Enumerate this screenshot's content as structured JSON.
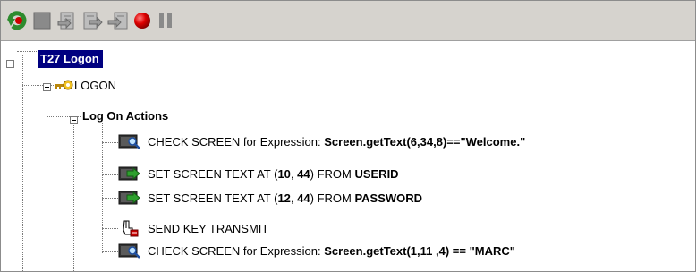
{
  "toolbar": {
    "buttons": [
      {
        "name": "run-icon",
        "color": "#2e8b2e"
      },
      {
        "name": "stop-icon",
        "color": "#808080"
      },
      {
        "name": "step-into-icon",
        "color": "#7a7a7a"
      },
      {
        "name": "step-over-icon",
        "color": "#7a7a7a"
      },
      {
        "name": "step-out-icon",
        "color": "#7a7a7a"
      },
      {
        "name": "record-icon",
        "color": "#cc0000"
      },
      {
        "name": "pause-icon",
        "color": "#7a7a7a"
      }
    ]
  },
  "tree": {
    "root": {
      "label": "T27 Logon"
    },
    "logon": {
      "label": "LOGON"
    },
    "actions_group": {
      "label": "Log On Actions"
    },
    "actions": [
      {
        "prefix": "CHECK SCREEN for Expression: ",
        "strong": "Screen.getText(6,34,8)==\"Welcome.\""
      },
      {
        "p1": "SET SCREEN TEXT AT (",
        "b1": "10",
        "p2": ", ",
        "b2": "44",
        "p3": ") FROM ",
        "b3": "USERID"
      },
      {
        "p1": "SET SCREEN TEXT AT (",
        "b1": "12",
        "p2": ", ",
        "b2": "44",
        "p3": ") FROM ",
        "b3": "PASSWORD"
      },
      {
        "label": "SEND KEY TRANSMIT"
      },
      {
        "prefix": "CHECK SCREEN for Expression: ",
        "strong": "Screen.getText(1,11 ,4) == \"MARC\""
      }
    ]
  }
}
